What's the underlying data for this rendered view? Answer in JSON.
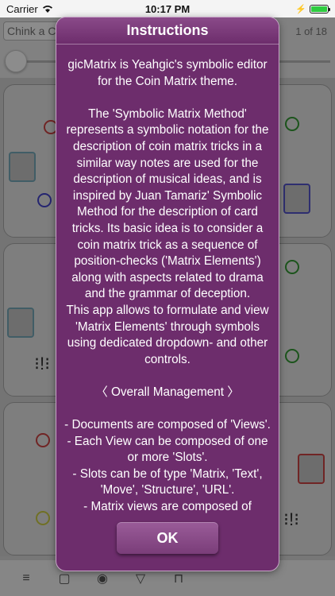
{
  "status_bar": {
    "carrier": "Carrier",
    "time": "10:17 PM"
  },
  "toolbar": {
    "search_placeholder": "Chink a Coin",
    "page_counter": "1 of 18"
  },
  "bottom_toolbar": {
    "icons": [
      "≡",
      "▢",
      "◉",
      "▽",
      "⊓"
    ]
  },
  "modal": {
    "title": "Instructions",
    "paragraphs": [
      "gicMatrix is Yeahgic's symbolic editor for the Coin Matrix theme.",
      "The 'Symbolic Matrix Method' represents a symbolic notation for the description of coin matrix tricks in a similar way notes are used for the description of musical ideas, and is inspired by Juan Tamariz' Symbolic Method for the description of card tricks. Its basic idea is to consider a coin matrix trick as a sequence of position-checks ('Matrix Elements') along with aspects related to drama and the grammar of deception.",
      "This app allows to formulate and view 'Matrix Elements' through symbols using dedicated dropdown- and other controls.",
      "〈 Overall Management 〉",
      "- Documents are composed of 'Views'.",
      "- Each View can be composed of one or more 'Slots'.",
      "- Slots can be of type 'Matrix, 'Text', 'Move', 'Structure', 'URL'.",
      "- Matrix views are composed of"
    ],
    "ok_label": "OK"
  },
  "colors": {
    "modal_bg": "#6d2d6c",
    "accent": "#8a4a89"
  }
}
